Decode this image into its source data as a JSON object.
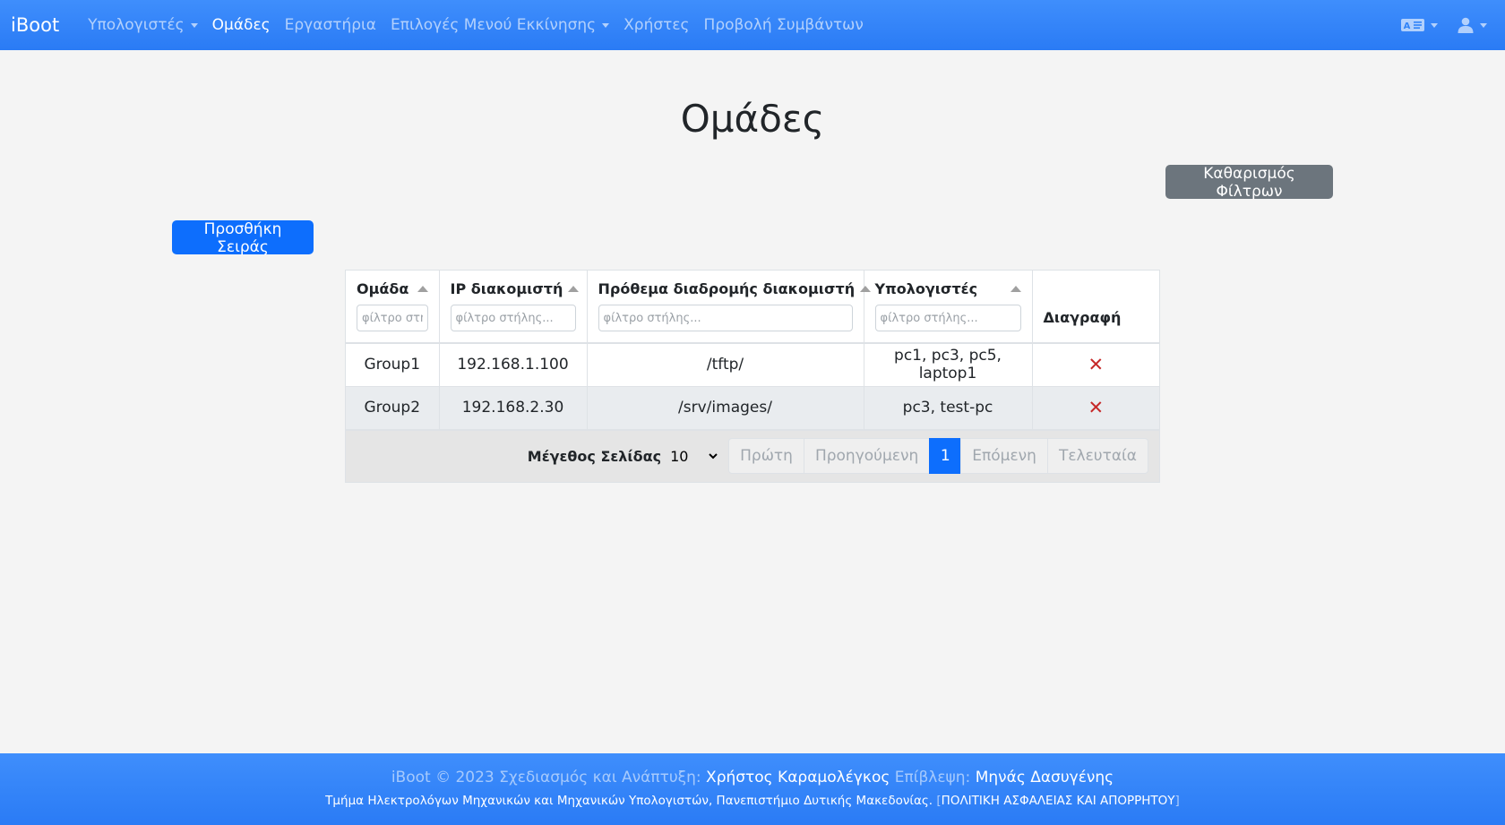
{
  "navbar": {
    "brand": "iBoot",
    "items": [
      {
        "label": "Υπολογιστές",
        "dropdown": true,
        "active": false
      },
      {
        "label": "Ομάδες",
        "dropdown": false,
        "active": true
      },
      {
        "label": "Εργαστήρια",
        "dropdown": false,
        "active": false
      },
      {
        "label": "Επιλογές Μενού Εκκίνησης",
        "dropdown": true,
        "active": false
      },
      {
        "label": "Χρήστες",
        "dropdown": false,
        "active": false
      },
      {
        "label": "Προβολή Συμβάντων",
        "dropdown": false,
        "active": false
      }
    ],
    "right_icons": [
      "language-icon",
      "user-icon"
    ]
  },
  "page": {
    "title": "Ομάδες",
    "clear_filters_label": "Καθαρισμός Φίλτρων",
    "add_row_label": "Προσθήκη Σειράς"
  },
  "table": {
    "columns": [
      {
        "label": "Ομάδα",
        "filter_placeholder": "φίλτρο στήλης..."
      },
      {
        "label": "IP διακομιστή",
        "filter_placeholder": "φίλτρο στήλης..."
      },
      {
        "label": "Πρόθεμα διαδρομής διακομιστή",
        "filter_placeholder": "φίλτρο στήλης..."
      },
      {
        "label": "Υπολογιστές",
        "filter_placeholder": "φίλτρο στήλης..."
      },
      {
        "label": "Διαγραφή"
      }
    ],
    "rows": [
      {
        "group": "Group1",
        "ip": "192.168.1.100",
        "prefix": "/tftp/",
        "computers": "pc1, pc3, pc5, laptop1",
        "delete": "✕"
      },
      {
        "group": "Group2",
        "ip": "192.168.2.30",
        "prefix": "/srv/images/",
        "computers": "pc3, test-pc",
        "delete": "✕"
      }
    ],
    "pagination": {
      "page_size_label": "Μέγεθος Σελίδας",
      "page_size": "10",
      "first": "Πρώτη",
      "previous": "Προηγούμενη",
      "current": "1",
      "next": "Επόμενη",
      "last": "Τελευταία"
    }
  },
  "footer": {
    "copyright": "iBoot © 2023 Σχεδιασμός και Ανάπτυξη:",
    "developer": "Χρήστος Καραμολέγκος",
    "supervision_label": "Επίβλεψη:",
    "supervisor": "Μηνάς Δασυγένης",
    "department": "Τμήμα Ηλεκτρολόγων Μηχανικών και Μηχανικών Υπολογιστών, Πανεπιστήμιο Δυτικής Μακεδονίας.",
    "bracket_open": "[",
    "privacy_link": "ΠΟΛΙΤΙΚΗ ΑΣΦΑΛΕΙΑΣ ΚΑΙ ΑΠΟΡΡΗΤΟΥ",
    "bracket_close": "]"
  },
  "colors": {
    "navbar": "#3f8efc",
    "primary": "#0d6efd",
    "secondary": "#6c757d",
    "danger": "#c62828"
  }
}
